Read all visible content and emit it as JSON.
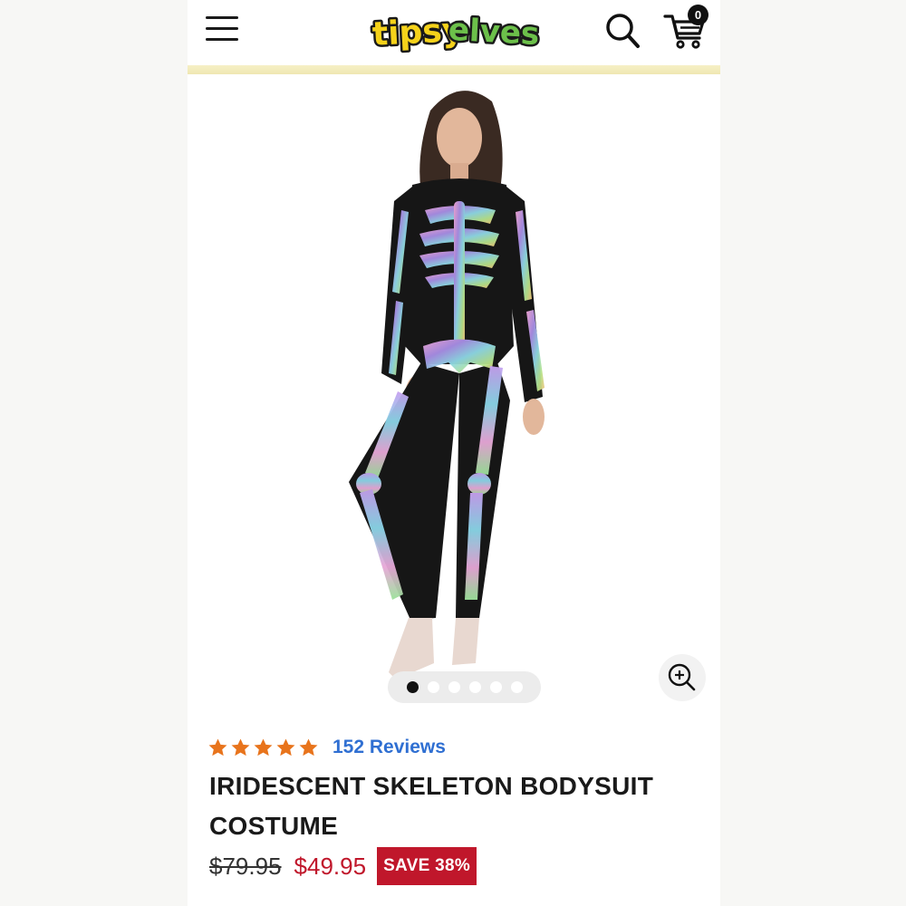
{
  "header": {
    "brand": "tipsyelves",
    "brand_tipsy": "tipsy",
    "brand_elves": "elves",
    "cart_count": "0"
  },
  "icons": {
    "menu": "hamburger-menu-icon",
    "search": "search-icon",
    "cart": "cart-icon",
    "zoom": "zoom-in-icon",
    "star": "star-icon"
  },
  "gallery": {
    "slide_count": 6,
    "active_index": 0
  },
  "product": {
    "rating": 5,
    "reviews_label": "152 Reviews",
    "title": "IRIDESCENT SKELETON BODYSUIT COSTUME",
    "original_price": "$79.95",
    "sale_price": "$49.95",
    "save_label": "SAVE 38%"
  },
  "colors": {
    "accent_red": "#c0172b",
    "review_link_blue": "#2f6fd2",
    "star_orange": "#e8741c",
    "logo_yellow": "#f5d21a",
    "logo_green": "#6cc04a"
  }
}
